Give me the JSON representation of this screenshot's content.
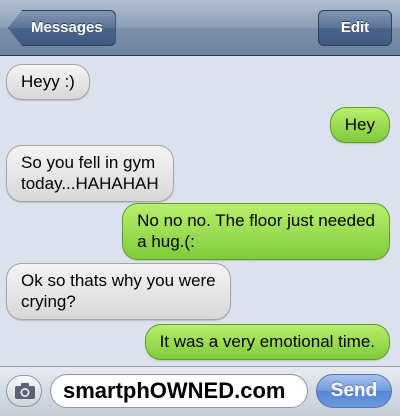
{
  "navbar": {
    "back_label": "Messages",
    "edit_label": "Edit"
  },
  "messages": [
    {
      "direction": "incoming",
      "text": "Heyy :)"
    },
    {
      "direction": "outgoing",
      "text": "Hey"
    },
    {
      "direction": "incoming",
      "text": "So you fell in gym\ntoday...HAHAHAH"
    },
    {
      "direction": "outgoing",
      "text": "No no no. The floor just needed\na hug.(:"
    },
    {
      "direction": "incoming",
      "text": "Ok so thats why you were\ncrying?"
    },
    {
      "direction": "outgoing",
      "text": "It was a very emotional time."
    }
  ],
  "composer": {
    "input_value": "smartphOWNED.com",
    "send_label": "Send",
    "camera_icon": "camera-icon"
  },
  "colors": {
    "incoming_bubble": "#e6e6e6",
    "outgoing_bubble": "#9ade52",
    "send_button": "#6a97e0",
    "navbar": "#7d90aa"
  }
}
